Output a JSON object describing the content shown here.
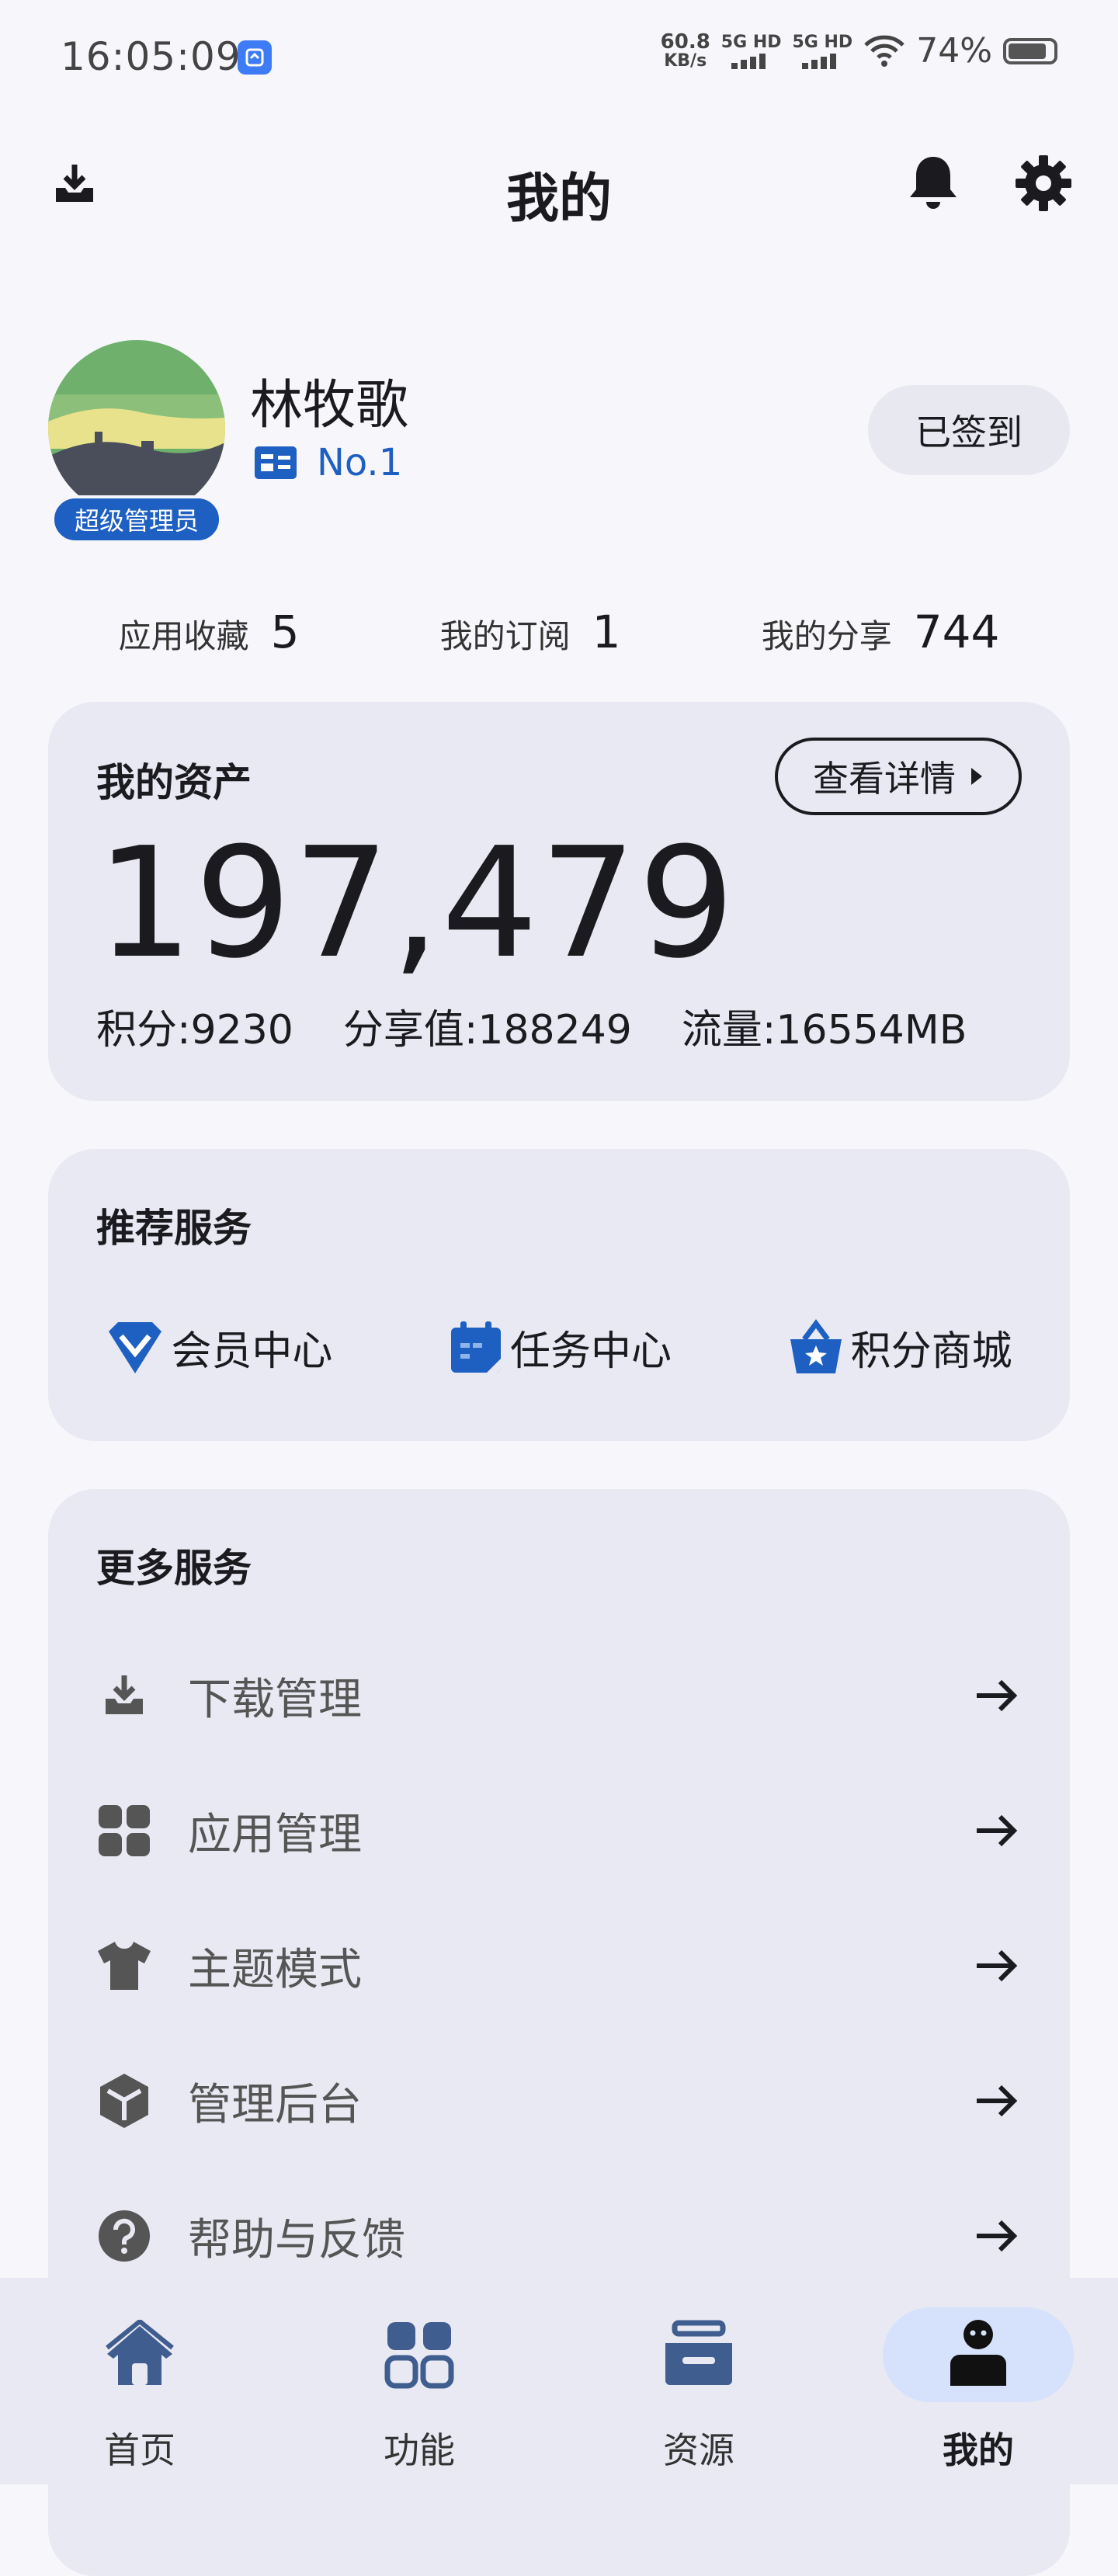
{
  "status_bar": {
    "time": "16:05:09",
    "net_speed": "60.8",
    "net_unit": "KB/s",
    "sim1": "5G HD",
    "sim2": "5G HD",
    "battery": "74%"
  },
  "header": {
    "title": "我的",
    "icons": [
      "download-tray-icon",
      "bell-icon",
      "gear-icon"
    ]
  },
  "profile": {
    "name": "林牧歌",
    "role": "超级管理员",
    "rank": "No.1",
    "signin_label": "已签到"
  },
  "stats": [
    {
      "label": "应用收藏",
      "value": "5"
    },
    {
      "label": "我的订阅",
      "value": "1"
    },
    {
      "label": "我的分享",
      "value": "744"
    }
  ],
  "assets": {
    "title": "我的资产",
    "details_label": "查看详情",
    "total": "197,479",
    "points": "积分:9230",
    "share_value": "分享值:188249",
    "traffic": "流量:16554MB"
  },
  "services": {
    "title": "推荐服务",
    "items": [
      {
        "label": "会员中心",
        "icon": "diamond-icon"
      },
      {
        "label": "任务中心",
        "icon": "calendar-icon"
      },
      {
        "label": "积分商城",
        "icon": "shopping-basket-icon"
      }
    ]
  },
  "more_services": {
    "title": "更多服务",
    "items": [
      {
        "label": "下载管理",
        "icon": "download-tray-icon"
      },
      {
        "label": "应用管理",
        "icon": "apps-grid-icon"
      },
      {
        "label": "主题模式",
        "icon": "tshirt-icon"
      },
      {
        "label": "管理后台",
        "icon": "cube-icon"
      },
      {
        "label": "帮助与反馈",
        "icon": "help-circle-icon"
      }
    ]
  },
  "bottom_nav": {
    "items": [
      {
        "label": "首页",
        "icon": "home-icon"
      },
      {
        "label": "功能",
        "icon": "apps-grid-icon"
      },
      {
        "label": "资源",
        "icon": "inbox-icon"
      },
      {
        "label": "我的",
        "icon": "person-icon"
      }
    ],
    "active": "我的"
  },
  "colors": {
    "accent": "#1e5fc2",
    "card_bg": "#e9e9f3",
    "page_bg": "#f6f6fb",
    "active_pill": "#d6e2fb"
  }
}
